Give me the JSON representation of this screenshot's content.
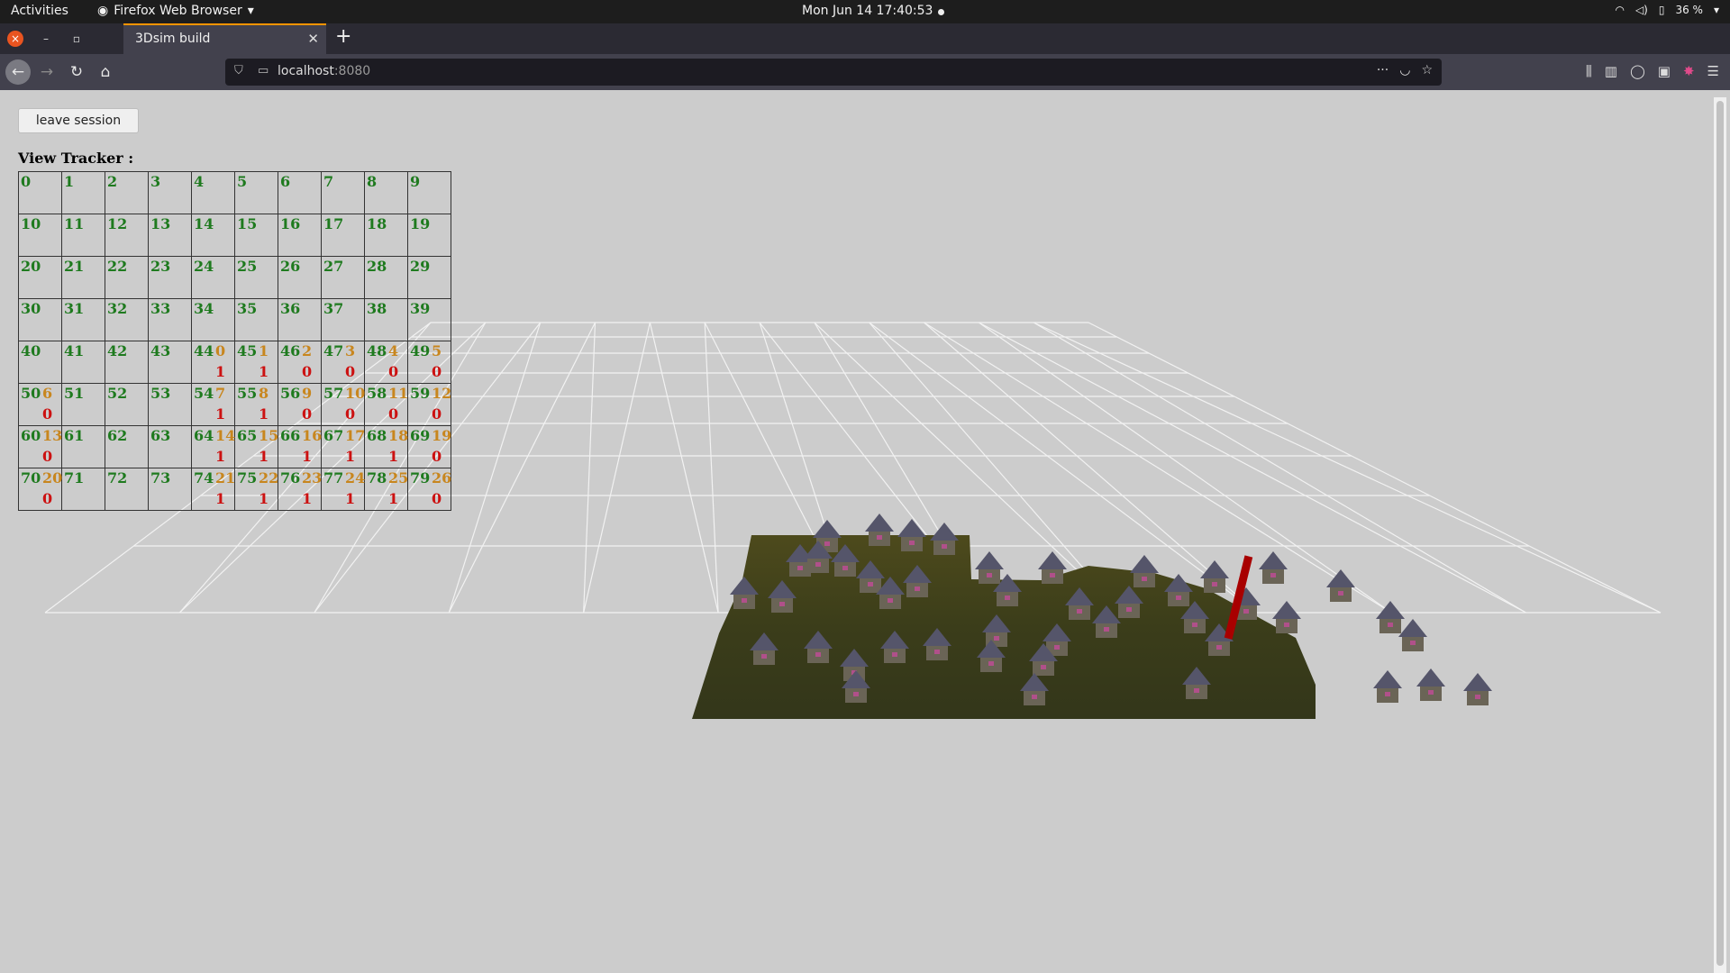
{
  "topbar": {
    "activities": "Activities",
    "app_name": "Firefox Web Browser",
    "clock": "Mon Jun 14  17:40:53",
    "battery": "36 %"
  },
  "browser": {
    "tab_title": "3Dsim build",
    "url_host": "localhost",
    "url_port": ":8080"
  },
  "page": {
    "leave_button": "leave session",
    "tracker_title": "View Tracker :",
    "tracker_rows": [
      [
        {
          "id": "0"
        },
        {
          "id": "1"
        },
        {
          "id": "2"
        },
        {
          "id": "3"
        },
        {
          "id": "4"
        },
        {
          "id": "5"
        },
        {
          "id": "6"
        },
        {
          "id": "7"
        },
        {
          "id": "8"
        },
        {
          "id": "9"
        }
      ],
      [
        {
          "id": "10"
        },
        {
          "id": "11"
        },
        {
          "id": "12"
        },
        {
          "id": "13"
        },
        {
          "id": "14"
        },
        {
          "id": "15"
        },
        {
          "id": "16"
        },
        {
          "id": "17"
        },
        {
          "id": "18"
        },
        {
          "id": "19"
        }
      ],
      [
        {
          "id": "20"
        },
        {
          "id": "21"
        },
        {
          "id": "22"
        },
        {
          "id": "23"
        },
        {
          "id": "24"
        },
        {
          "id": "25"
        },
        {
          "id": "26"
        },
        {
          "id": "27"
        },
        {
          "id": "28"
        },
        {
          "id": "29"
        }
      ],
      [
        {
          "id": "30"
        },
        {
          "id": "31"
        },
        {
          "id": "32"
        },
        {
          "id": "33"
        },
        {
          "id": "34"
        },
        {
          "id": "35"
        },
        {
          "id": "36"
        },
        {
          "id": "37"
        },
        {
          "id": "38"
        },
        {
          "id": "39"
        }
      ],
      [
        {
          "id": "40"
        },
        {
          "id": "41"
        },
        {
          "id": "42"
        },
        {
          "id": "43"
        },
        {
          "id": "44",
          "v": "0",
          "f": "1"
        },
        {
          "id": "45",
          "v": "1",
          "f": "1"
        },
        {
          "id": "46",
          "v": "2",
          "f": "0"
        },
        {
          "id": "47",
          "v": "3",
          "f": "0"
        },
        {
          "id": "48",
          "v": "4",
          "f": "0"
        },
        {
          "id": "49",
          "v": "5",
          "f": "0"
        }
      ],
      [
        {
          "id": "50",
          "v": "6",
          "f": "0"
        },
        {
          "id": "51"
        },
        {
          "id": "52"
        },
        {
          "id": "53"
        },
        {
          "id": "54",
          "v": "7",
          "f": "1"
        },
        {
          "id": "55",
          "v": "8",
          "f": "1"
        },
        {
          "id": "56",
          "v": "9",
          "f": "0"
        },
        {
          "id": "57",
          "v": "10",
          "f": "0"
        },
        {
          "id": "58",
          "v": "11",
          "f": "0"
        },
        {
          "id": "59",
          "v": "12",
          "f": "0"
        }
      ],
      [
        {
          "id": "60",
          "v": "13",
          "f": "0"
        },
        {
          "id": "61"
        },
        {
          "id": "62"
        },
        {
          "id": "63"
        },
        {
          "id": "64",
          "v": "14",
          "f": "1"
        },
        {
          "id": "65",
          "v": "15",
          "f": "1"
        },
        {
          "id": "66",
          "v": "16",
          "f": "1"
        },
        {
          "id": "67",
          "v": "17",
          "f": "1"
        },
        {
          "id": "68",
          "v": "18",
          "f": "1"
        },
        {
          "id": "69",
          "v": "19",
          "f": "0"
        }
      ],
      [
        {
          "id": "70",
          "v": "20",
          "f": "0"
        },
        {
          "id": "71"
        },
        {
          "id": "72"
        },
        {
          "id": "73"
        },
        {
          "id": "74",
          "v": "21",
          "f": "1"
        },
        {
          "id": "75",
          "v": "22",
          "f": "1"
        },
        {
          "id": "76",
          "v": "23",
          "f": "1"
        },
        {
          "id": "77",
          "v": "24",
          "f": "1"
        },
        {
          "id": "78",
          "v": "25",
          "f": "1"
        },
        {
          "id": "79",
          "v": "26",
          "f": "0"
        }
      ]
    ]
  },
  "colors": {
    "cell_id": "#1e7a1e",
    "cell_value": "#c8861e",
    "cell_flag": "#cc1111",
    "marker": "#a80000"
  }
}
